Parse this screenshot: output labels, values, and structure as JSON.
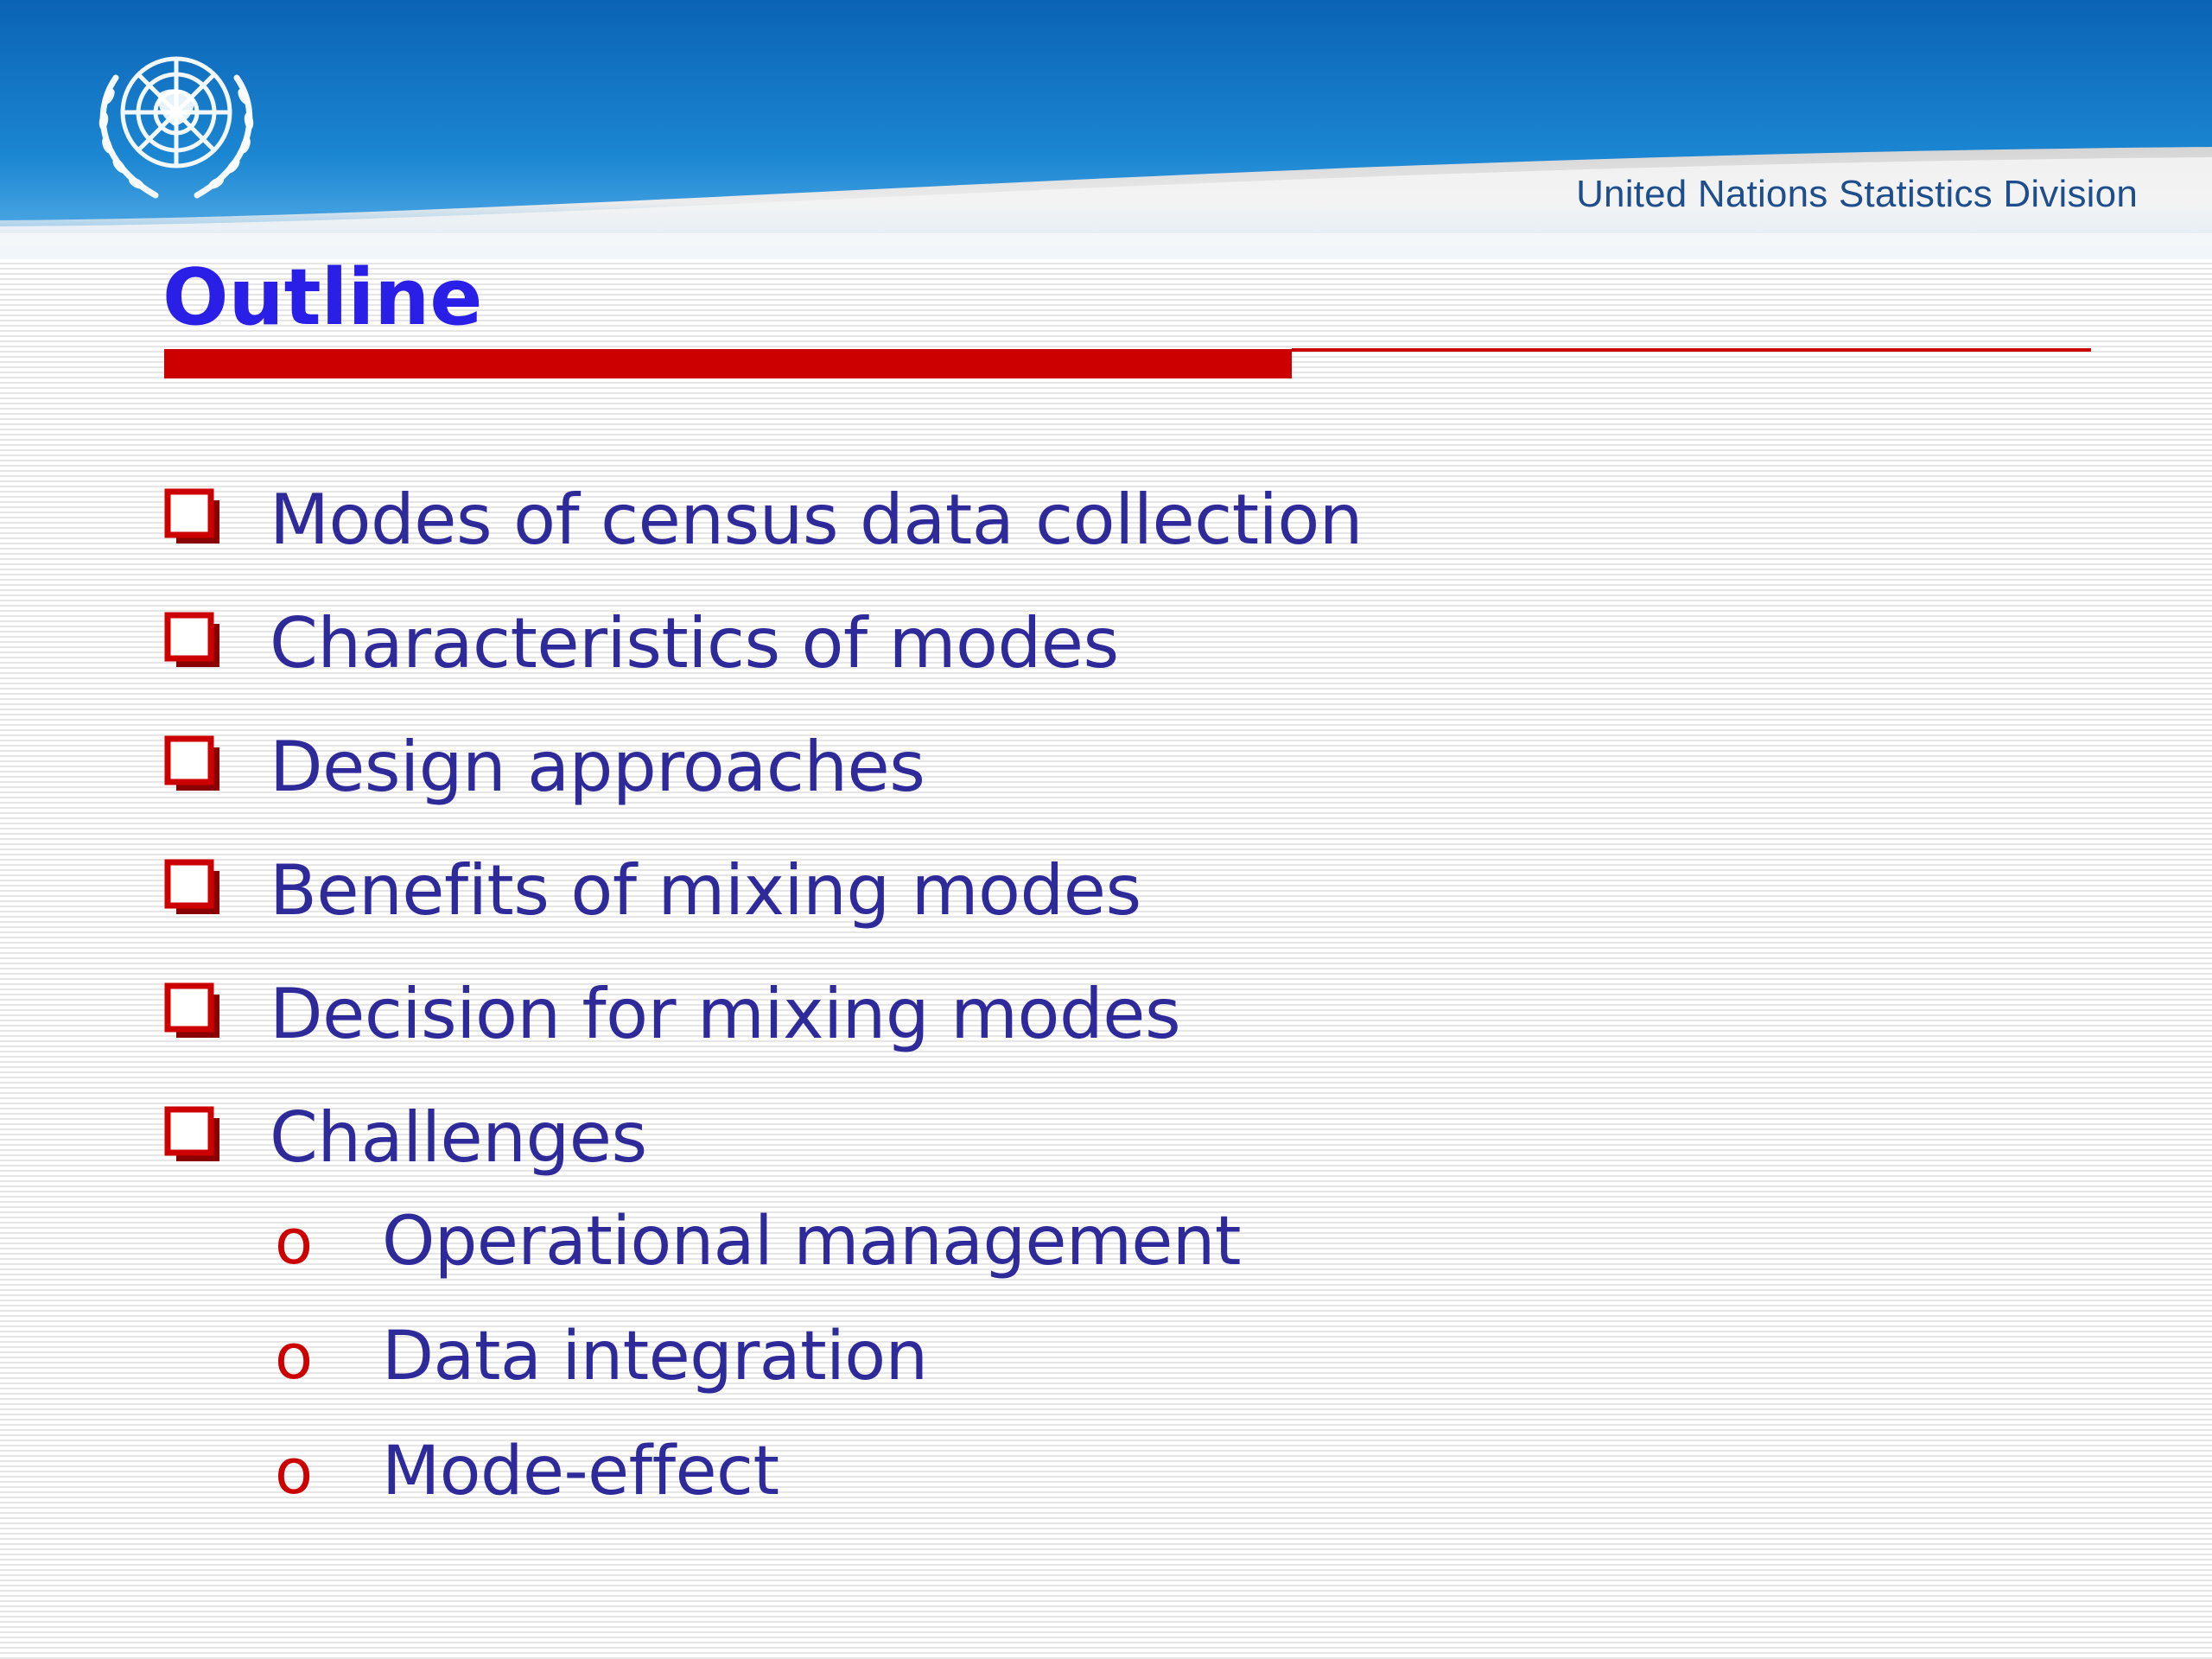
{
  "header": {
    "organization": "United Nations Statistics Division",
    "emblem_icon": "un-emblem-icon"
  },
  "title": "Outline",
  "outline": {
    "items": [
      {
        "label": "Modes of census data collection"
      },
      {
        "label": "Characteristics of modes"
      },
      {
        "label": "Design approaches"
      },
      {
        "label": "Benefits of mixing modes"
      },
      {
        "label": "Decision for mixing modes"
      },
      {
        "label": "Challenges"
      }
    ],
    "sub_items": [
      {
        "bullet": "o",
        "label": "Operational management"
      },
      {
        "bullet": "o",
        "label": "Data integration"
      },
      {
        "bullet": "o",
        "label": "Mode-effect"
      }
    ]
  },
  "colors": {
    "title": "#2a1fe6",
    "body_text": "#2e2a9a",
    "accent_red": "#cc0000",
    "banner_blue": "#0a6fc0",
    "division_text": "#1f4e8c"
  }
}
